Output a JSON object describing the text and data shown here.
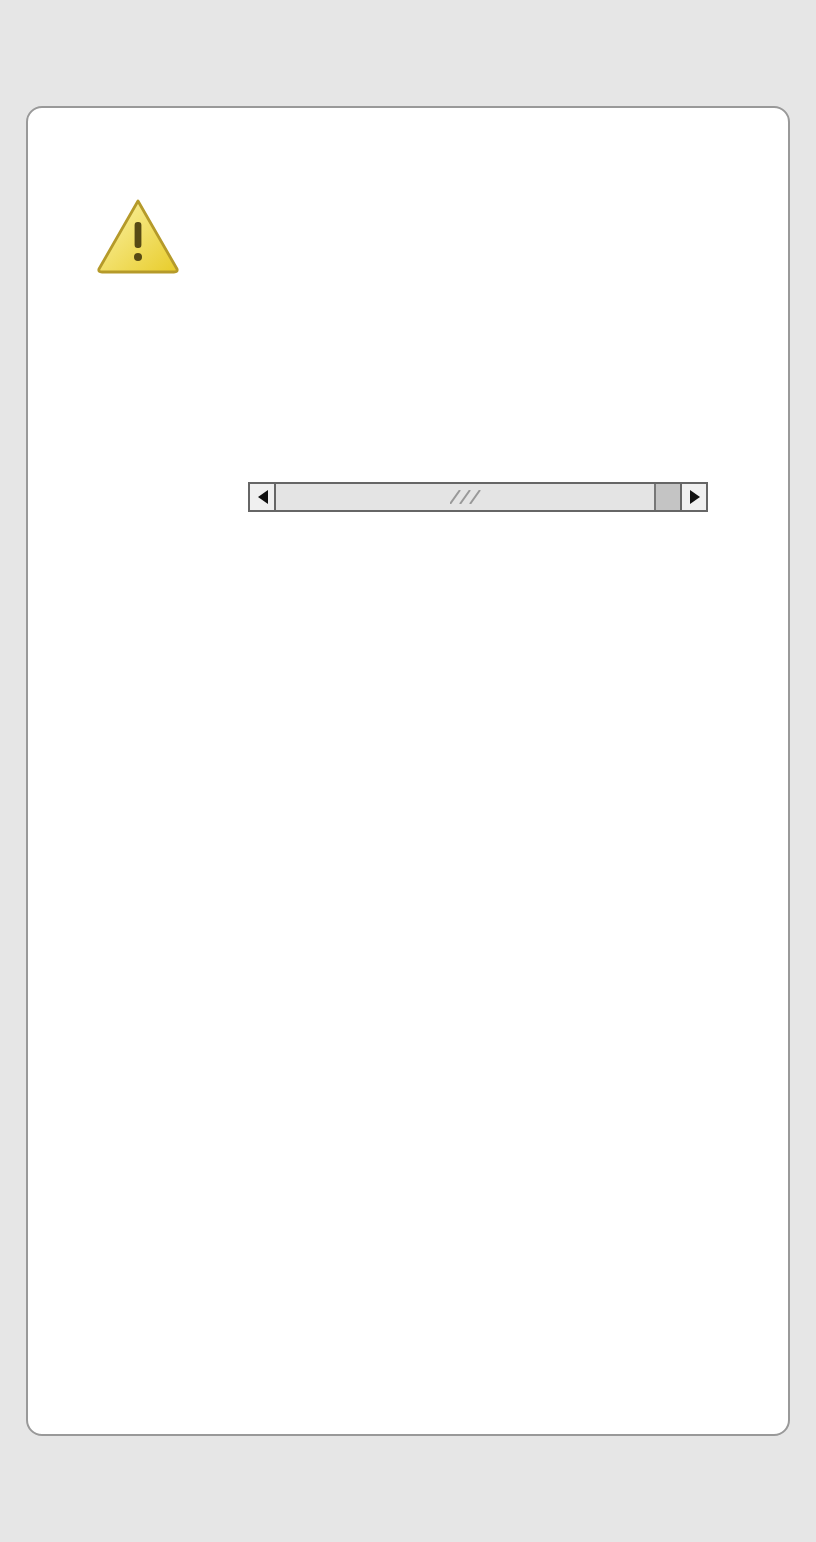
{
  "dialog": {
    "kind": "warning"
  }
}
